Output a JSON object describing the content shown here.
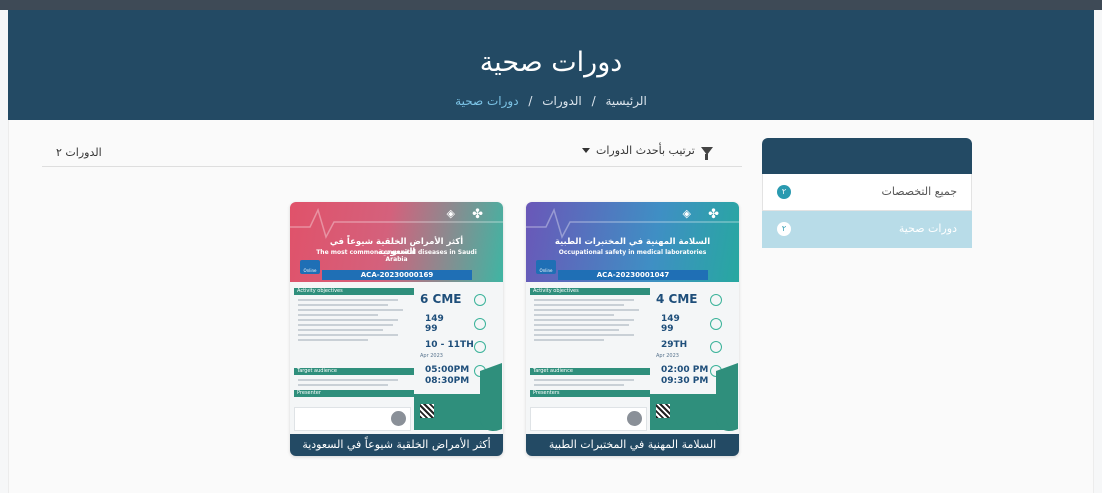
{
  "header": {
    "title": "دورات صحية",
    "breadcrumb": [
      "الرئيسية",
      "الدورات",
      "دورات صحية"
    ],
    "separator": "/"
  },
  "toolbar": {
    "count_label": "الدورات",
    "count_value": "٢",
    "sort_label": "ترتيب بأحدث الدورات"
  },
  "sidebar": {
    "items": [
      {
        "label": "جميع التخصصات",
        "count": "٢",
        "active": false
      },
      {
        "label": "دورات صحية",
        "count": "٢",
        "active": true
      }
    ]
  },
  "courses": [
    {
      "caption": "السلامة المهنية في المختبرات الطبية",
      "poster": {
        "title_ar": "السلامة المهنية في المختبرات الطبية",
        "title_en": "Occupational safety in medical laboratories",
        "online": "Online",
        "code": "ACA-20230001047",
        "objectives_label": "Activity objectives",
        "cme": "4 CME",
        "price_member": "149",
        "price_group": "99",
        "date": "29TH",
        "month": "Apr 2023",
        "time_start": "02:00 PM",
        "time_end": "09:30 PM",
        "audience_label": "Target audience",
        "presenter_label": "Presenters"
      }
    },
    {
      "caption": "أكثر الأمراض الخلقية شيوعاً في السعودية",
      "poster": {
        "title_ar": "أكثر الأمراض الخلقية شيوعاً في السعودية",
        "title_en": "The most common congenital diseases in Saudi Arabia",
        "online": "Online",
        "code": "ACA-20230000169",
        "objectives_label": "Activity objectives",
        "cme": "6 CME",
        "price_member": "149",
        "price_group": "99",
        "date": "10 - 11TH",
        "month": "Apr 2023",
        "time_start": "05:00PM",
        "time_end": "08:30PM",
        "audience_label": "Target audience",
        "presenter_label": "Presenter"
      }
    }
  ],
  "colors": {
    "header_bg": "#234a64",
    "accent": "#2a9ab0",
    "active_item_bg": "#b8dce8",
    "caption_bg": "#234a64"
  },
  "icons": {
    "filter": "filter-icon",
    "sort_dropdown": "caret-down-icon"
  }
}
